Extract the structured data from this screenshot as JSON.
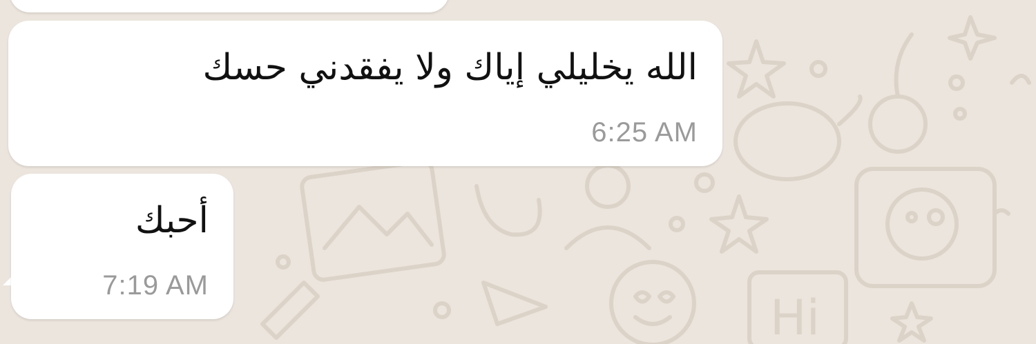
{
  "chat": {
    "wallpaper_color": "#ece5dd",
    "bubble_color": "#ffffff",
    "messages": [
      {
        "text": "",
        "time": ""
      },
      {
        "text": "الله يخليلي إياك ولا يفقدني حسك",
        "time": "6:25 AM"
      },
      {
        "text": "أحبك",
        "time": "7:19 AM"
      }
    ]
  }
}
